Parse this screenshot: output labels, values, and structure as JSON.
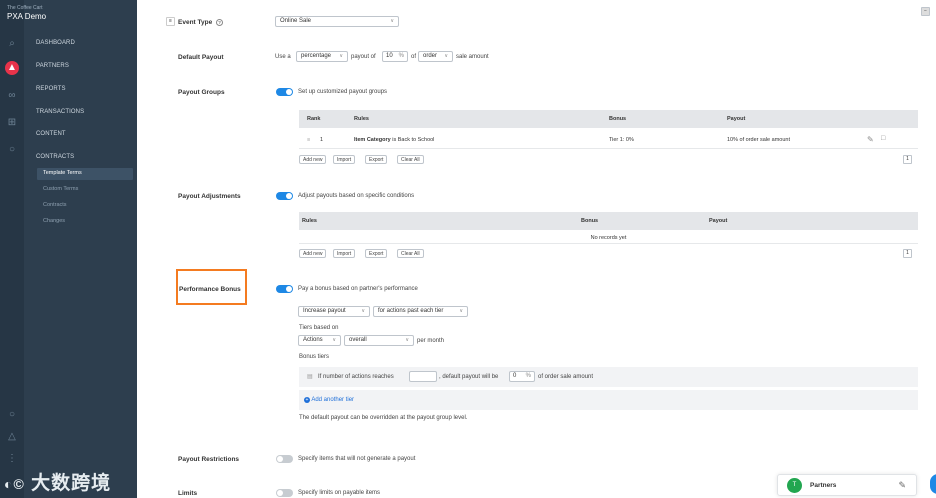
{
  "brand": {
    "sub": "The Coffee Cart",
    "name": "PXA Demo"
  },
  "nav": {
    "dashboard": "DASHBOARD",
    "partners": "PARTNERS",
    "reports": "REPORTS",
    "transactions": "TRANSACTIONS",
    "content": "CONTENT",
    "contracts": "CONTRACTS",
    "sub": {
      "template_terms": "Template Terms",
      "custom_terms": "Custom Terms",
      "contracts": "Contracts",
      "changes": "Changes"
    }
  },
  "watermark": "大数跨境",
  "event_type": {
    "label": "Event Type",
    "help": "?",
    "value": "Online Sale"
  },
  "default_payout": {
    "label": "Default Payout",
    "use_a": "Use a",
    "type": "percentage",
    "payout_of": "payout of",
    "amount": "10",
    "pct": "%",
    "of": "of",
    "basis": "order",
    "suffix": "sale amount"
  },
  "payout_groups": {
    "label": "Payout Groups",
    "toggle_text": "Set up customized payout groups",
    "headers": {
      "rank": "Rank",
      "rules": "Rules",
      "bonus": "Bonus",
      "payout": "Payout"
    },
    "row": {
      "rank": "1",
      "rule_bold": "Item Category",
      "rule_rest": "is Back to School",
      "bonus": "Tier 1: 0%",
      "payout": "10% of order sale amount"
    },
    "buttons": {
      "add": "Add new",
      "import": "Import",
      "export": "Export",
      "clear": "Clear All"
    },
    "pager": "1"
  },
  "payout_adjustments": {
    "label": "Payout Adjustments",
    "toggle_text": "Adjust payouts based on specific conditions",
    "headers": {
      "rules": "Rules",
      "bonus": "Bonus",
      "payout": "Payout"
    },
    "empty": "No records yet",
    "buttons": {
      "add": "Add new",
      "import": "Import",
      "export": "Export",
      "clear": "Clear All"
    },
    "pager": "1"
  },
  "performance_bonus": {
    "label": "Performance Bonus",
    "toggle_text": "Pay a bonus based on partner's performance",
    "mode": "Increase payout",
    "trigger": "for actions past each tier",
    "tiers_based_on": "Tiers based on",
    "metric": "Actions",
    "scope": "overall",
    "per": "per month",
    "bonus_tiers": "Bonus tiers",
    "tier_prefix": "If number of actions reaches",
    "tier_mid": ", default payout will be",
    "tier_value": "0",
    "tier_pct": "%",
    "tier_suffix": "of order sale amount",
    "add_tier": "Add another tier",
    "note": "The default payout can be overridden at the payout group level."
  },
  "payout_restrictions": {
    "label": "Payout Restrictions",
    "toggle_text": "Specify items that will not generate a payout"
  },
  "limits": {
    "label": "Limits",
    "toggle_text": "Specify limits on payable items"
  },
  "chat": {
    "initial": "T",
    "label": "Partners"
  },
  "colors": {
    "accent": "#1e88e5",
    "highlight": "#f47b20",
    "sidebar": "#2d3e4e"
  }
}
